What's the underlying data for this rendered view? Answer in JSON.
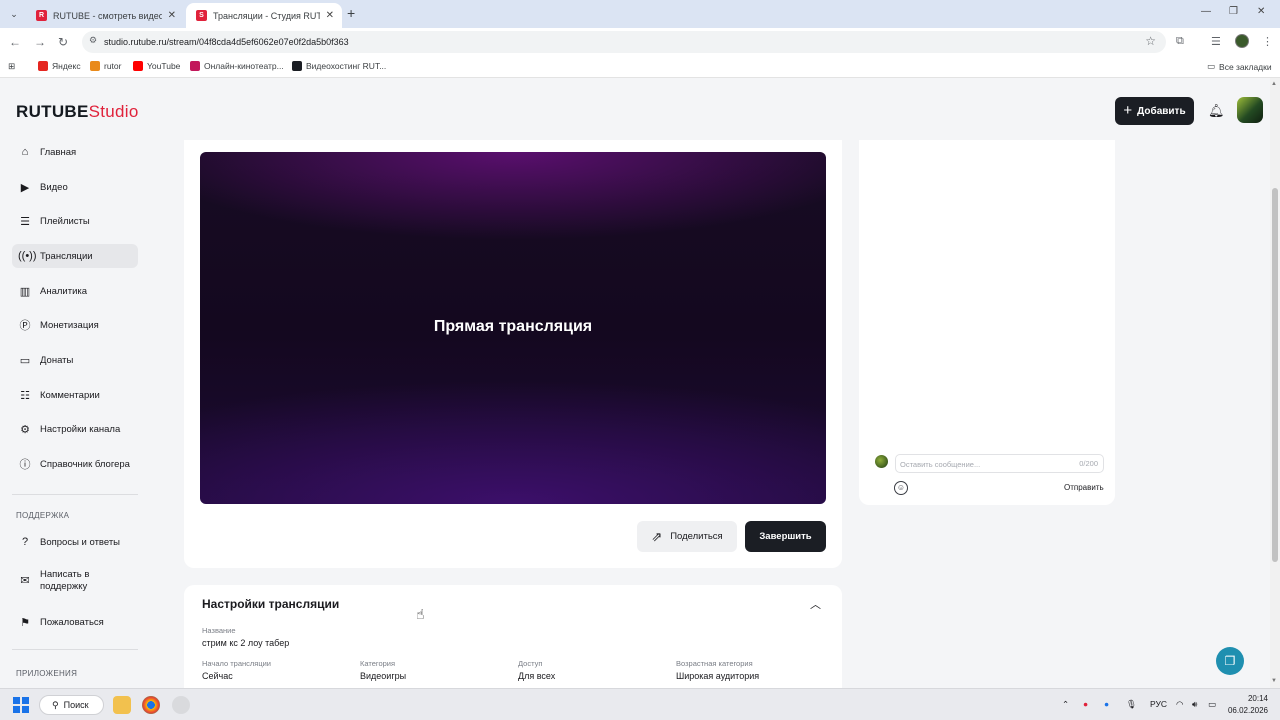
{
  "browser": {
    "tabs": [
      {
        "title": "RUTUBE - смотреть видео онл",
        "active": false
      },
      {
        "title": "Трансляции - Студия RUTUBE",
        "active": true
      }
    ],
    "url": "studio.rutube.ru/stream/04f8cda4d5ef6062e07e0f2da5b0f363",
    "bookmarks": [
      {
        "label": "Яндекс",
        "color": "#e52620"
      },
      {
        "label": "rutor",
        "color": "#e98a1a"
      },
      {
        "label": "YouTube",
        "color": "#ff0000"
      },
      {
        "label": "Онлайн-кинотеатр...",
        "color": "#c2185b"
      },
      {
        "label": "Видеохостинг RUT...",
        "color": "#1b1e24"
      }
    ],
    "all_bookmarks": "Все закладки"
  },
  "app": {
    "logo_main": "RUTUBE",
    "logo_sub": "Studio",
    "add_button": "Добавить",
    "accent_color": "#e0223b"
  },
  "sidebar": {
    "items": [
      {
        "label": "Главная",
        "icon": "home-icon"
      },
      {
        "label": "Видео",
        "icon": "video-icon"
      },
      {
        "label": "Плейлисты",
        "icon": "playlist-icon"
      },
      {
        "label": "Трансляции",
        "icon": "broadcast-icon",
        "active": true
      },
      {
        "label": "Аналитика",
        "icon": "analytics-icon"
      },
      {
        "label": "Монетизация",
        "icon": "monetization-icon"
      },
      {
        "label": "Донаты",
        "icon": "donate-icon"
      },
      {
        "label": "Комментарии",
        "icon": "comments-icon"
      },
      {
        "label": "Настройки канала",
        "icon": "gear-icon"
      },
      {
        "label": "Справочник блогера",
        "icon": "info-icon"
      }
    ],
    "support_section": "ПОДДЕРЖКА",
    "support_items": [
      {
        "label": "Вопросы и ответы",
        "icon": "help-icon"
      },
      {
        "label": "Написать в поддержку",
        "icon": "mail-icon"
      },
      {
        "label": "Пожаловаться",
        "icon": "flag-icon"
      }
    ],
    "apps_section": "ПРИЛОЖЕНИЯ"
  },
  "player": {
    "title": "Прямая трансляция",
    "share_button": "Поделиться",
    "finish_button": "Завершить"
  },
  "settings": {
    "title": "Настройки трансляции",
    "name_label": "Название",
    "name_value": "стрим кс 2 лоу табер",
    "fields": [
      {
        "label": "Начало трансляции",
        "value": "Сейчас"
      },
      {
        "label": "Категория",
        "value": "Видеоигры"
      },
      {
        "label": "Доступ",
        "value": "Для всех"
      },
      {
        "label": "Возрастная категория",
        "value": "Широкая аудитория"
      }
    ]
  },
  "chat": {
    "placeholder": "Оставить сообщение...",
    "counter": "0/200",
    "send_button": "Отправить"
  },
  "taskbar": {
    "search": "Поиск",
    "language": "РУС",
    "time": "20:14",
    "date": "06.02.2026"
  }
}
